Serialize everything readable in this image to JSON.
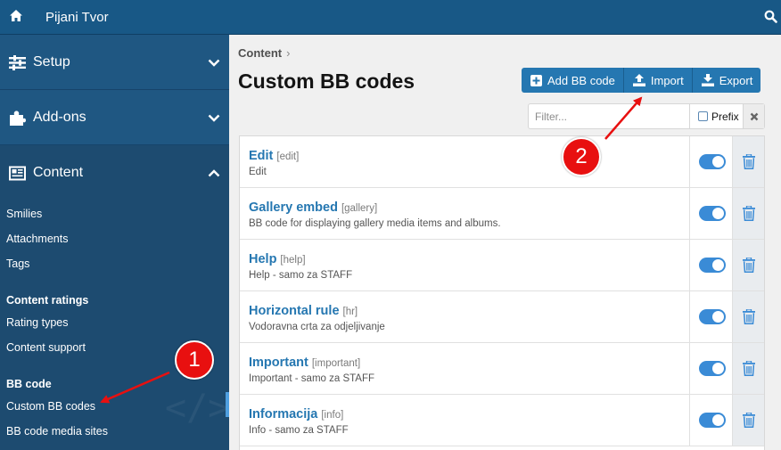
{
  "topbar": {
    "title": "Pijani Tvor",
    "home_icon": "home-icon",
    "search_icon": "search-icon"
  },
  "sidebar": {
    "sections": [
      {
        "label": "Setup",
        "icon": "sliders-icon",
        "expanded": false
      },
      {
        "label": "Add-ons",
        "icon": "puzzle-icon",
        "expanded": false
      },
      {
        "label": "Content",
        "icon": "newspaper-icon",
        "expanded": true
      }
    ],
    "items": [
      {
        "label": "Smilies"
      },
      {
        "label": "Attachments"
      },
      {
        "label": "Tags"
      },
      {
        "label": "Content ratings",
        "header": true
      },
      {
        "label": "Rating types"
      },
      {
        "label": "Content support"
      },
      {
        "label": "BB code",
        "header": true
      },
      {
        "label": "Custom BB codes",
        "active": true
      },
      {
        "label": "BB code media sites"
      }
    ]
  },
  "main": {
    "breadcrumb": "Content",
    "breadcrumb_sep": "›",
    "title": "Custom BB codes",
    "buttons": {
      "add": "Add BB code",
      "import": "Import",
      "export": "Export"
    },
    "filter": {
      "placeholder": "Filter...",
      "value": "",
      "prefix_label": "Prefix",
      "prefix_checked": false
    },
    "rows": [
      {
        "name": "Edit",
        "tag": "[edit]",
        "desc": "Edit",
        "enabled": true
      },
      {
        "name": "Gallery embed",
        "tag": "[gallery]",
        "desc": "BB code for displaying gallery media items and albums.",
        "enabled": true
      },
      {
        "name": "Help",
        "tag": "[help]",
        "desc": "Help - samo za STAFF",
        "enabled": true
      },
      {
        "name": "Horizontal rule",
        "tag": "[hr]",
        "desc": "Vodoravna crta za odjeljivanje",
        "enabled": true
      },
      {
        "name": "Important",
        "tag": "[important]",
        "desc": "Important - samo za STAFF",
        "enabled": true
      },
      {
        "name": "Informacija",
        "tag": "[info]",
        "desc": "Info - samo za STAFF",
        "enabled": true
      }
    ]
  },
  "annotations": [
    {
      "number": "1"
    },
    {
      "number": "2"
    }
  ],
  "colors": {
    "topbar": "#185886",
    "sidebar": "#1d4b70",
    "accent": "#2577b1",
    "toggle_on": "#3a8bd6",
    "annotation": "#e81010"
  }
}
